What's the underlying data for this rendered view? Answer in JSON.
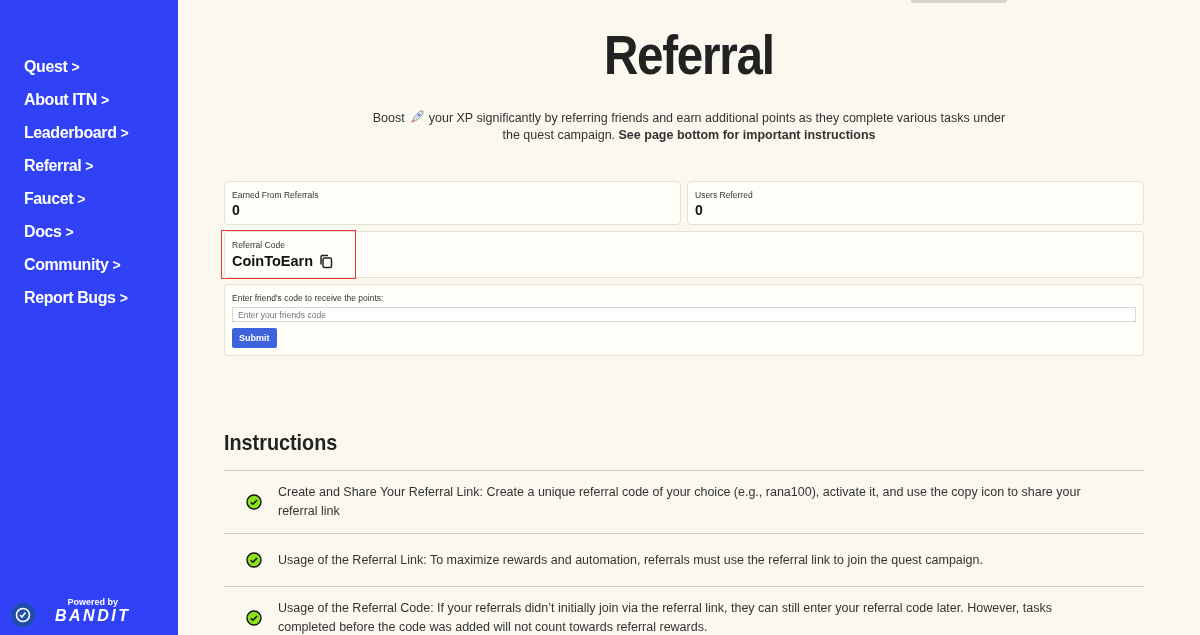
{
  "sidebar": {
    "items": [
      {
        "label": "Quest",
        "chevron": ">"
      },
      {
        "label": "About ITN",
        "chevron": ">"
      },
      {
        "label": "Leaderboard",
        "chevron": ">"
      },
      {
        "label": "Referral",
        "chevron": ">"
      },
      {
        "label": "Faucet",
        "chevron": ">"
      },
      {
        "label": "Docs",
        "chevron": ">"
      },
      {
        "label": "Community",
        "chevron": ">"
      },
      {
        "label": "Report Bugs",
        "chevron": ">"
      }
    ],
    "powered_by": "Powered by",
    "brand": "BANDIT"
  },
  "title": "Referral",
  "intro_lead": "Boost",
  "intro_rest": "your XP significantly by referring friends and earn additional points as they complete various tasks under the quest campaign. **See page bottom for important instructions**",
  "stats": [
    {
      "label": "Earned From Referrals",
      "value": "0"
    },
    {
      "label": "Users Referred",
      "value": "0"
    }
  ],
  "referral_code": {
    "label": "Referral Code",
    "value": "CoinToEarn",
    "highlighted": true
  },
  "friend_code": {
    "label": "Enter friend's code to receive the points:",
    "placeholder": "Enter your friends code",
    "button": "Submit"
  },
  "instructions": {
    "heading": "Instructions",
    "items": [
      {
        "text": "Create and Share Your Referral Link: Create a unique referral code of your choice (e.g., rana100), activate it, and use the copy icon to share your referral link"
      },
      {
        "text": "Usage of the Referral Link: To maximize rewards and automation, referrals must use the referral link to join the quest campaign."
      },
      {
        "text": "Usage of the Referral Code: If your referrals didn’t initially join via the referral link, they can still enter your referral code later. However, tasks completed before the code was added will not count towards referral rewards."
      }
    ]
  }
}
